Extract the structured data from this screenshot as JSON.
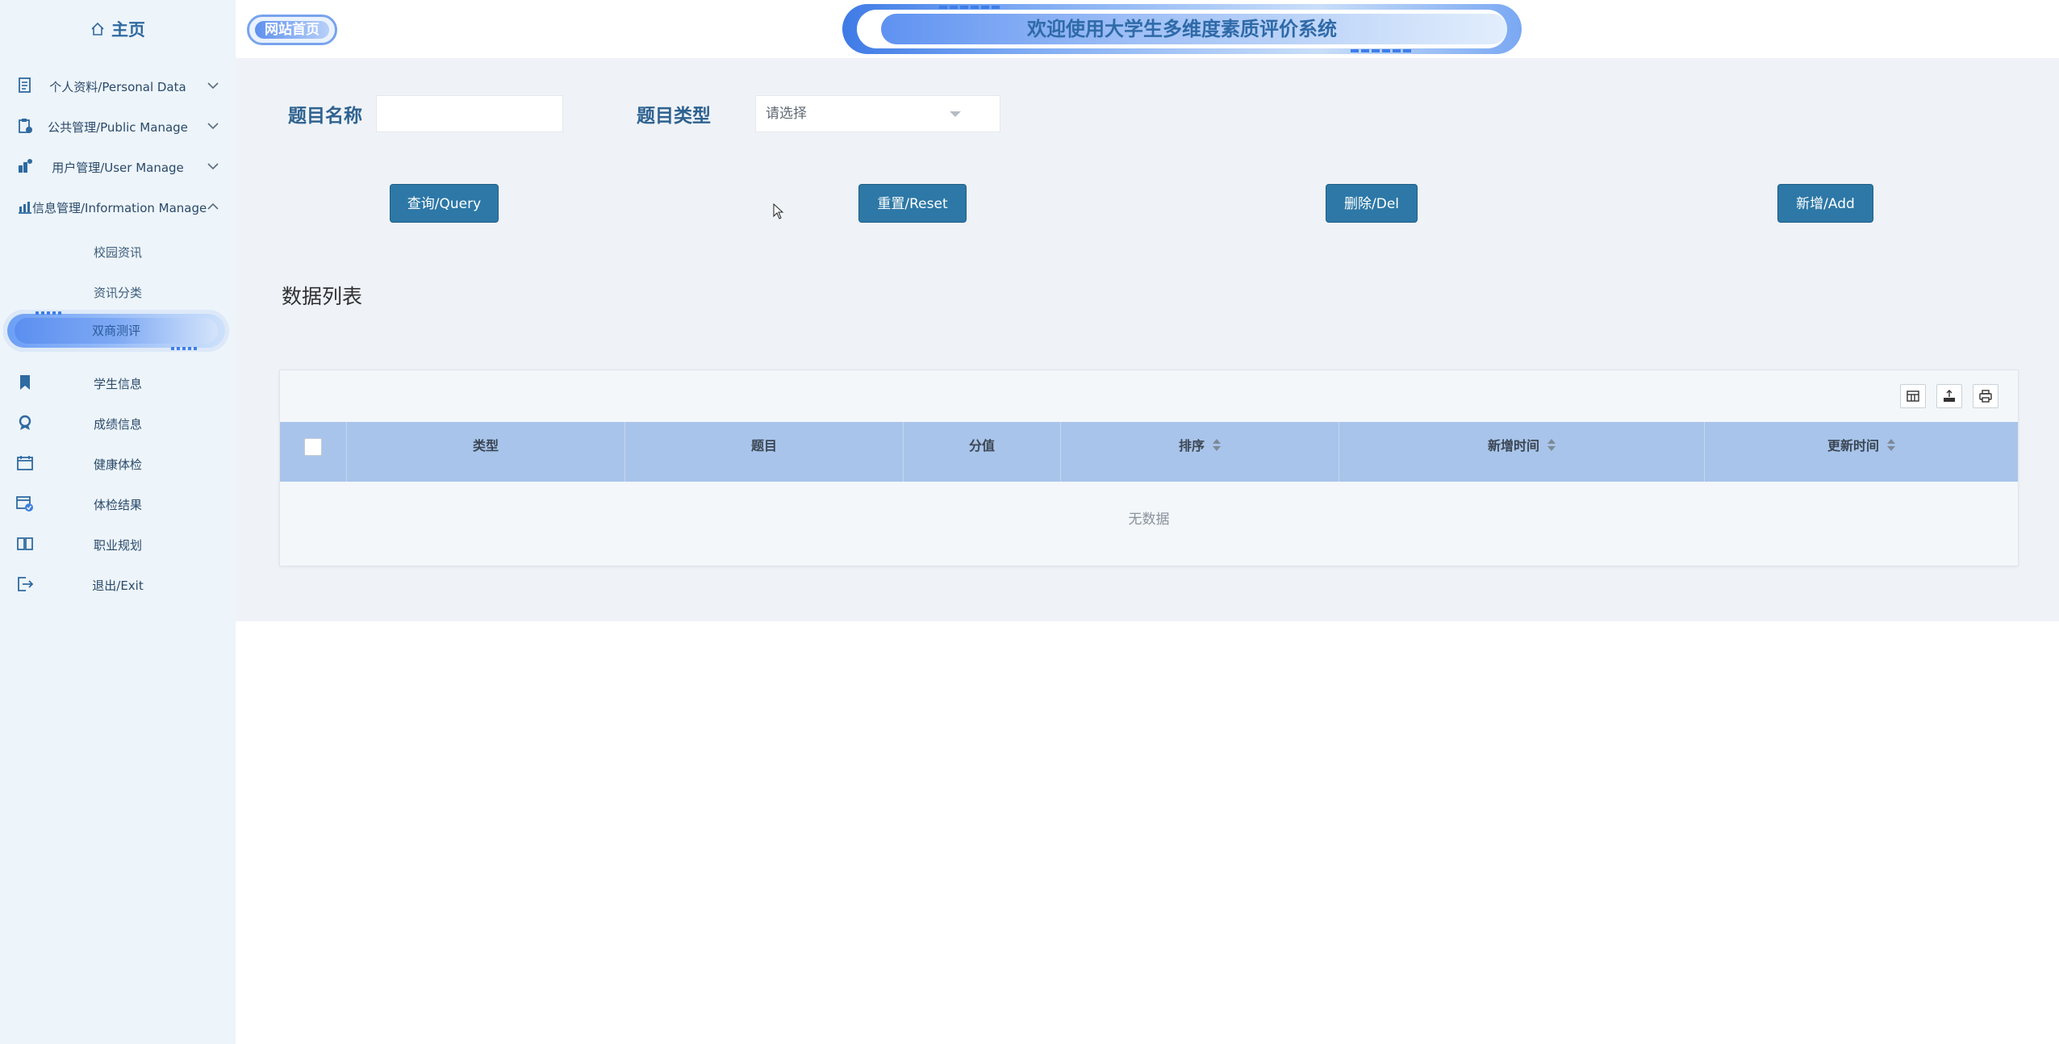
{
  "sidebar": {
    "home_label": "主页",
    "menus": [
      {
        "label": "个人资料/Personal Data",
        "icon": "document-icon",
        "expanded": false
      },
      {
        "label": "公共管理/Public Manage",
        "icon": "clipboard-icon",
        "expanded": false
      },
      {
        "label": "用户管理/User Manage",
        "icon": "user-manage-icon",
        "expanded": false
      },
      {
        "label": "信息管理/Information Manage",
        "icon": "chart-icon",
        "expanded": true
      }
    ],
    "sub_items": [
      "校园资讯",
      "资讯分类",
      "双商测评"
    ],
    "active_sub": "双商测评",
    "bottom_items": [
      {
        "label": "学生信息",
        "icon": "bookmark-icon"
      },
      {
        "label": "成绩信息",
        "icon": "award-icon"
      },
      {
        "label": "健康体检",
        "icon": "calendar-icon"
      },
      {
        "label": "体检结果",
        "icon": "calendar-check-icon"
      },
      {
        "label": "职业规划",
        "icon": "book-icon"
      },
      {
        "label": "退出/Exit",
        "icon": "logout-icon"
      }
    ]
  },
  "header": {
    "site_button": "网站首页",
    "welcome": "欢迎使用大学生多维度素质评价系统"
  },
  "search": {
    "name_label": "题目名称",
    "name_value": "",
    "type_label": "题目类型",
    "type_placeholder": "请选择"
  },
  "buttons": {
    "query": "查询/Query",
    "reset": "重置/Reset",
    "delete": "删除/Del",
    "add": "新增/Add"
  },
  "list": {
    "title": "数据列表",
    "columns": [
      "类型",
      "题目",
      "分值",
      "排序",
      "新增时间",
      "更新时间"
    ],
    "empty_text": "无数据"
  },
  "colors": {
    "accent": "#2d78a6",
    "header_row": "#a8c4ea",
    "sidebar_bg": "#edf4fa"
  }
}
